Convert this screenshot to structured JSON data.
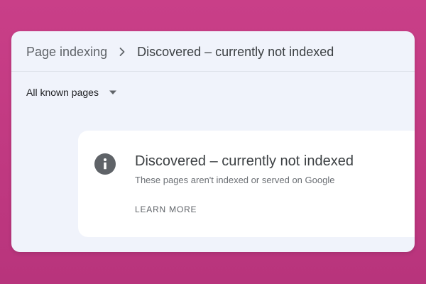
{
  "breadcrumb": {
    "parent": "Page indexing",
    "separator_icon": "chevron-right-icon",
    "current": "Discovered – currently not indexed"
  },
  "filter": {
    "selected": "All known pages",
    "caret_icon": "dropdown-caret-icon"
  },
  "status_card": {
    "icon": "info-icon",
    "title": "Discovered – currently not indexed",
    "description": "These pages aren't indexed or served on Google",
    "action_label": "LEARN MORE"
  },
  "colors": {
    "background": "#c23a82",
    "panel": "#f0f3fb",
    "card": "#ffffff",
    "icon": "#5f6368"
  }
}
